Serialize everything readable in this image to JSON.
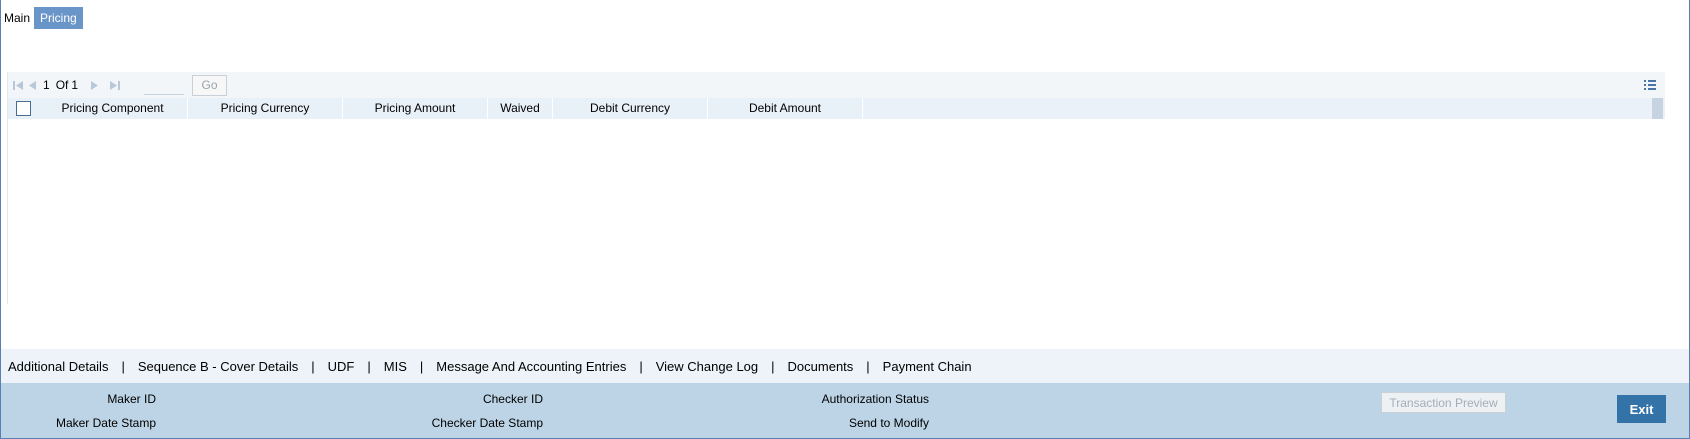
{
  "tabs": [
    {
      "label": "Main"
    },
    {
      "label": "Pricing"
    }
  ],
  "pager": {
    "current": "1",
    "of_label": "Of",
    "total": "1",
    "page_input": "",
    "go_label": "Go"
  },
  "grid": {
    "columns": [
      "Pricing Component",
      "Pricing Currency",
      "Pricing Amount",
      "Waived",
      "Debit Currency",
      "Debit Amount"
    ],
    "rows": []
  },
  "links": [
    "Additional Details",
    "Sequence B - Cover Details",
    "UDF",
    "MIS",
    "Message And Accounting Entries",
    "View Change Log",
    "Documents",
    "Payment Chain"
  ],
  "link_separator": "|",
  "footer": {
    "maker_id": "Maker ID",
    "maker_date": "Maker Date Stamp",
    "checker_id": "Checker ID",
    "checker_date": "Checker Date Stamp",
    "auth_status": "Authorization Status",
    "send_modify": "Send to Modify",
    "preview_label": "Transaction Preview",
    "exit_label": "Exit"
  },
  "colors": {
    "active_tab": "#6a95c9",
    "footer_bg": "#bcd4e6",
    "exit_bg": "#3373a8"
  }
}
